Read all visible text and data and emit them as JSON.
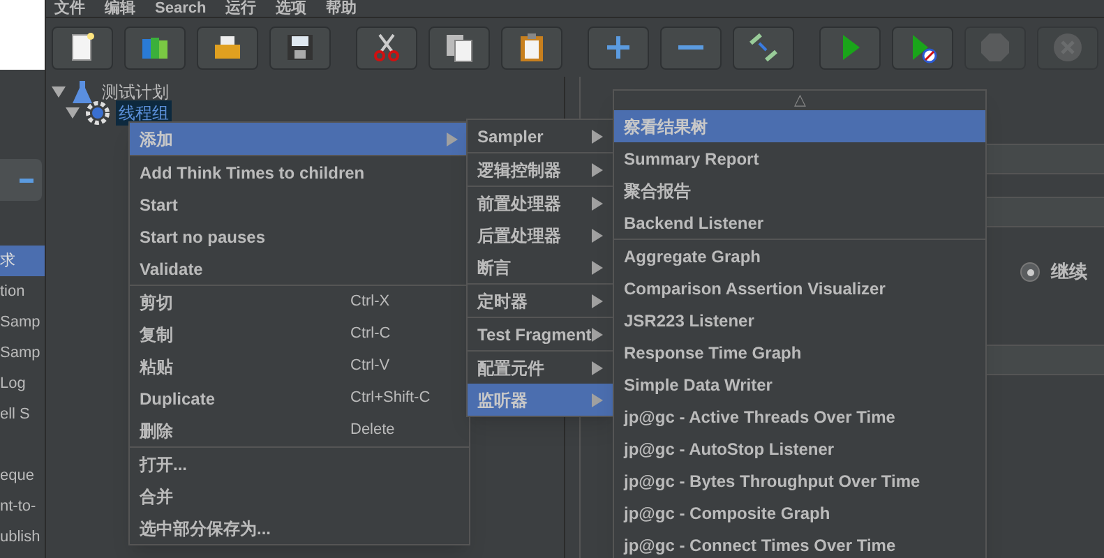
{
  "menu_bar": [
    "文件",
    "编辑",
    "Search",
    "运行",
    "选项",
    "帮助"
  ],
  "toolbar": [
    {
      "kind": "new",
      "disabled": false
    },
    {
      "kind": "templates",
      "disabled": false
    },
    {
      "kind": "open",
      "disabled": false
    },
    {
      "kind": "save",
      "disabled": false
    },
    {
      "kind": "cut",
      "disabled": false
    },
    {
      "kind": "copy",
      "disabled": false
    },
    {
      "kind": "paste",
      "disabled": false
    },
    {
      "kind": "expand",
      "disabled": false
    },
    {
      "kind": "collapse",
      "disabled": false
    },
    {
      "kind": "toggle",
      "disabled": false
    },
    {
      "kind": "start",
      "disabled": false
    },
    {
      "kind": "start_no_timers",
      "disabled": false
    },
    {
      "kind": "stop",
      "disabled": true
    },
    {
      "kind": "shutdown",
      "disabled": true
    }
  ],
  "background_window": {
    "items": [
      {
        "label": "求",
        "selected": true
      },
      {
        "label": "tion",
        "selected": false
      },
      {
        "label": "Samp",
        "selected": false
      },
      {
        "label": "Samp",
        "selected": false
      },
      {
        "label": "Log",
        "selected": false
      },
      {
        "label": "ell S",
        "selected": false
      },
      {
        "label": "eque",
        "selected": false
      },
      {
        "label": "nt-to-",
        "selected": false
      },
      {
        "label": "ublish",
        "selected": false
      }
    ]
  },
  "tree": [
    {
      "label": "测试计划",
      "kind": "plan",
      "selected": false,
      "children": [
        {
          "label": "线程组",
          "kind": "thread_group",
          "selected": true
        }
      ]
    }
  ],
  "right_panel": {
    "radio": {
      "label": "继续",
      "selected": true
    }
  },
  "context_menu": {
    "sections": [
      [
        {
          "label": "添加",
          "selected": true,
          "submenu": true
        }
      ],
      [
        {
          "label": "Add Think Times to children",
          "selected": false,
          "submenu": false
        },
        {
          "label": "Start",
          "selected": false,
          "submenu": false
        },
        {
          "label": "Start no pauses",
          "selected": false,
          "submenu": false
        },
        {
          "label": "Validate",
          "selected": false,
          "submenu": false
        }
      ],
      [
        {
          "label": "剪切",
          "shortcut": "Ctrl-X",
          "selected": false,
          "submenu": false
        },
        {
          "label": "复制",
          "shortcut": "Ctrl-C",
          "selected": false,
          "submenu": false
        },
        {
          "label": "粘贴",
          "shortcut": "Ctrl-V",
          "selected": false,
          "submenu": false
        },
        {
          "label": "Duplicate",
          "shortcut": "Ctrl+Shift-C",
          "selected": false,
          "submenu": false
        },
        {
          "label": "删除",
          "shortcut": "Delete",
          "selected": false,
          "submenu": false
        }
      ],
      [
        {
          "label": "打开...",
          "selected": false,
          "submenu": false
        },
        {
          "label": "合并",
          "selected": false,
          "submenu": false
        },
        {
          "label": "选中部分保存为...",
          "selected": false,
          "submenu": false
        }
      ]
    ]
  },
  "add_submenu": {
    "sections": [
      [
        {
          "label": "Sampler",
          "selected": false,
          "submenu": true
        }
      ],
      [
        {
          "label": "逻辑控制器",
          "selected": false,
          "submenu": true
        }
      ],
      [
        {
          "label": "前置处理器",
          "selected": false,
          "submenu": true
        },
        {
          "label": "后置处理器",
          "selected": false,
          "submenu": true
        },
        {
          "label": "断言",
          "selected": false,
          "submenu": true
        }
      ],
      [
        {
          "label": "定时器",
          "selected": false,
          "submenu": true
        }
      ],
      [
        {
          "label": "Test Fragment",
          "selected": false,
          "submenu": true
        }
      ],
      [
        {
          "label": "配置元件",
          "selected": false,
          "submenu": true
        },
        {
          "label": "监听器",
          "selected": true,
          "submenu": true
        }
      ]
    ]
  },
  "listener_submenu": {
    "scroll_up": "△",
    "sections": [
      [
        {
          "label": "察看结果树",
          "selected": true
        },
        {
          "label": "Summary Report",
          "selected": false
        },
        {
          "label": "聚合报告",
          "selected": false
        },
        {
          "label": "Backend Listener",
          "selected": false
        }
      ],
      [
        {
          "label": "Aggregate Graph",
          "selected": false
        },
        {
          "label": "Comparison Assertion Visualizer",
          "selected": false
        },
        {
          "label": "JSR223 Listener",
          "selected": false
        },
        {
          "label": "Response Time Graph",
          "selected": false
        },
        {
          "label": "Simple Data Writer",
          "selected": false
        },
        {
          "label": "jp@gc - Active Threads Over Time",
          "selected": false
        },
        {
          "label": "jp@gc - AutoStop Listener",
          "selected": false
        },
        {
          "label": "jp@gc - Bytes Throughput Over Time",
          "selected": false
        },
        {
          "label": "jp@gc - Composite Graph",
          "selected": false
        },
        {
          "label": "jp@gc - Connect Times Over Time",
          "selected": false
        }
      ]
    ]
  }
}
